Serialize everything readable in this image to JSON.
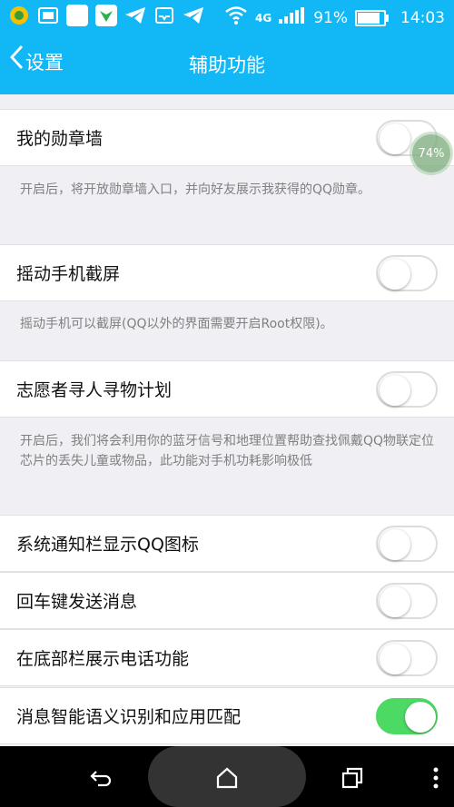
{
  "status_bar": {
    "battery_percent": "91%",
    "time": "14:03",
    "network": "4G",
    "battery_level": 0.91
  },
  "header": {
    "back_label": "设置",
    "title": "辅助功能"
  },
  "settings": [
    {
      "label": "我的勋章墙",
      "enabled": false,
      "description": "开启后，将开放勋章墙入口，并向好友展示我获得的QQ勋章。"
    },
    {
      "label": "摇动手机截屏",
      "enabled": false,
      "description": "摇动手机可以截屏(QQ以外的界面需要开启Root权限)。"
    },
    {
      "label": "志愿者寻人寻物计划",
      "enabled": false,
      "description": "开启后，我们将会利用你的蓝牙信号和地理位置帮助查找佩戴QQ物联定位芯片的丢失儿童或物品，此功能对手机功耗影响极低"
    },
    {
      "label": "系统通知栏显示QQ图标",
      "enabled": false
    },
    {
      "label": "回车键发送消息",
      "enabled": false
    },
    {
      "label": "在底部栏展示电话功能",
      "enabled": false
    },
    {
      "label": "消息智能语义识别和应用匹配",
      "enabled": true
    }
  ],
  "floating_badge": "74%",
  "colors": {
    "accent": "#12b7f5",
    "toggle_on": "#4cd964"
  },
  "icons": {
    "back": "chevron-left-icon",
    "nav_back": "back-arrow-icon",
    "nav_home": "home-icon",
    "nav_recents": "recents-icon",
    "nav_menu": "more-vertical-icon"
  }
}
